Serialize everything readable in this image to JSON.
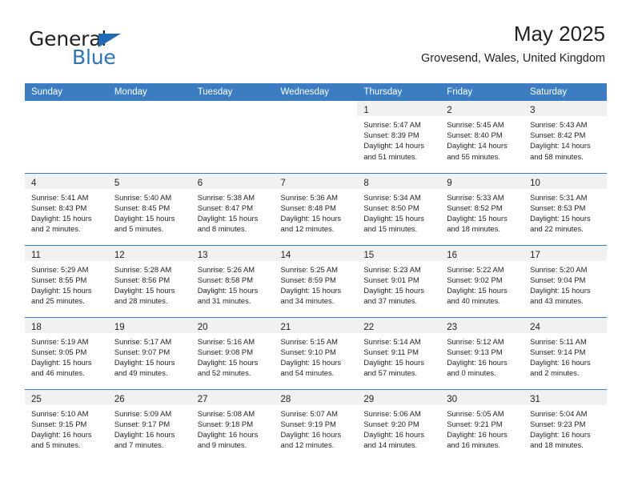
{
  "brand": {
    "name_top": "General",
    "name_bottom": "Blue",
    "triangle_color": "#1f6cb4",
    "blue_color": "#2e74b5"
  },
  "header": {
    "title": "May 2025",
    "subtitle": "Grovesend, Wales, United Kingdom",
    "header_bg": "#3b7dc0",
    "header_text_color": "#ffffff",
    "daycell_strip_bg": "#f1f1f1"
  },
  "weekday_headers": [
    "Sunday",
    "Monday",
    "Tuesday",
    "Wednesday",
    "Thursday",
    "Friday",
    "Saturday"
  ],
  "weeks": [
    [
      {
        "day": "",
        "sunrise": "",
        "sunset": "",
        "daylight_1": "",
        "daylight_2": "",
        "empty": true
      },
      {
        "day": "",
        "sunrise": "",
        "sunset": "",
        "daylight_1": "",
        "daylight_2": "",
        "empty": true
      },
      {
        "day": "",
        "sunrise": "",
        "sunset": "",
        "daylight_1": "",
        "daylight_2": "",
        "empty": true
      },
      {
        "day": "",
        "sunrise": "",
        "sunset": "",
        "daylight_1": "",
        "daylight_2": "",
        "empty": true
      },
      {
        "day": "1",
        "sunrise": "Sunrise: 5:47 AM",
        "sunset": "Sunset: 8:39 PM",
        "daylight_1": "Daylight: 14 hours",
        "daylight_2": "and 51 minutes."
      },
      {
        "day": "2",
        "sunrise": "Sunrise: 5:45 AM",
        "sunset": "Sunset: 8:40 PM",
        "daylight_1": "Daylight: 14 hours",
        "daylight_2": "and 55 minutes."
      },
      {
        "day": "3",
        "sunrise": "Sunrise: 5:43 AM",
        "sunset": "Sunset: 8:42 PM",
        "daylight_1": "Daylight: 14 hours",
        "daylight_2": "and 58 minutes."
      }
    ],
    [
      {
        "day": "4",
        "sunrise": "Sunrise: 5:41 AM",
        "sunset": "Sunset: 8:43 PM",
        "daylight_1": "Daylight: 15 hours",
        "daylight_2": "and 2 minutes."
      },
      {
        "day": "5",
        "sunrise": "Sunrise: 5:40 AM",
        "sunset": "Sunset: 8:45 PM",
        "daylight_1": "Daylight: 15 hours",
        "daylight_2": "and 5 minutes."
      },
      {
        "day": "6",
        "sunrise": "Sunrise: 5:38 AM",
        "sunset": "Sunset: 8:47 PM",
        "daylight_1": "Daylight: 15 hours",
        "daylight_2": "and 8 minutes."
      },
      {
        "day": "7",
        "sunrise": "Sunrise: 5:36 AM",
        "sunset": "Sunset: 8:48 PM",
        "daylight_1": "Daylight: 15 hours",
        "daylight_2": "and 12 minutes."
      },
      {
        "day": "8",
        "sunrise": "Sunrise: 5:34 AM",
        "sunset": "Sunset: 8:50 PM",
        "daylight_1": "Daylight: 15 hours",
        "daylight_2": "and 15 minutes."
      },
      {
        "day": "9",
        "sunrise": "Sunrise: 5:33 AM",
        "sunset": "Sunset: 8:52 PM",
        "daylight_1": "Daylight: 15 hours",
        "daylight_2": "and 18 minutes."
      },
      {
        "day": "10",
        "sunrise": "Sunrise: 5:31 AM",
        "sunset": "Sunset: 8:53 PM",
        "daylight_1": "Daylight: 15 hours",
        "daylight_2": "and 22 minutes."
      }
    ],
    [
      {
        "day": "11",
        "sunrise": "Sunrise: 5:29 AM",
        "sunset": "Sunset: 8:55 PM",
        "daylight_1": "Daylight: 15 hours",
        "daylight_2": "and 25 minutes."
      },
      {
        "day": "12",
        "sunrise": "Sunrise: 5:28 AM",
        "sunset": "Sunset: 8:56 PM",
        "daylight_1": "Daylight: 15 hours",
        "daylight_2": "and 28 minutes."
      },
      {
        "day": "13",
        "sunrise": "Sunrise: 5:26 AM",
        "sunset": "Sunset: 8:58 PM",
        "daylight_1": "Daylight: 15 hours",
        "daylight_2": "and 31 minutes."
      },
      {
        "day": "14",
        "sunrise": "Sunrise: 5:25 AM",
        "sunset": "Sunset: 8:59 PM",
        "daylight_1": "Daylight: 15 hours",
        "daylight_2": "and 34 minutes."
      },
      {
        "day": "15",
        "sunrise": "Sunrise: 5:23 AM",
        "sunset": "Sunset: 9:01 PM",
        "daylight_1": "Daylight: 15 hours",
        "daylight_2": "and 37 minutes."
      },
      {
        "day": "16",
        "sunrise": "Sunrise: 5:22 AM",
        "sunset": "Sunset: 9:02 PM",
        "daylight_1": "Daylight: 15 hours",
        "daylight_2": "and 40 minutes."
      },
      {
        "day": "17",
        "sunrise": "Sunrise: 5:20 AM",
        "sunset": "Sunset: 9:04 PM",
        "daylight_1": "Daylight: 15 hours",
        "daylight_2": "and 43 minutes."
      }
    ],
    [
      {
        "day": "18",
        "sunrise": "Sunrise: 5:19 AM",
        "sunset": "Sunset: 9:05 PM",
        "daylight_1": "Daylight: 15 hours",
        "daylight_2": "and 46 minutes."
      },
      {
        "day": "19",
        "sunrise": "Sunrise: 5:17 AM",
        "sunset": "Sunset: 9:07 PM",
        "daylight_1": "Daylight: 15 hours",
        "daylight_2": "and 49 minutes."
      },
      {
        "day": "20",
        "sunrise": "Sunrise: 5:16 AM",
        "sunset": "Sunset: 9:08 PM",
        "daylight_1": "Daylight: 15 hours",
        "daylight_2": "and 52 minutes."
      },
      {
        "day": "21",
        "sunrise": "Sunrise: 5:15 AM",
        "sunset": "Sunset: 9:10 PM",
        "daylight_1": "Daylight: 15 hours",
        "daylight_2": "and 54 minutes."
      },
      {
        "day": "22",
        "sunrise": "Sunrise: 5:14 AM",
        "sunset": "Sunset: 9:11 PM",
        "daylight_1": "Daylight: 15 hours",
        "daylight_2": "and 57 minutes."
      },
      {
        "day": "23",
        "sunrise": "Sunrise: 5:12 AM",
        "sunset": "Sunset: 9:13 PM",
        "daylight_1": "Daylight: 16 hours",
        "daylight_2": "and 0 minutes."
      },
      {
        "day": "24",
        "sunrise": "Sunrise: 5:11 AM",
        "sunset": "Sunset: 9:14 PM",
        "daylight_1": "Daylight: 16 hours",
        "daylight_2": "and 2 minutes."
      }
    ],
    [
      {
        "day": "25",
        "sunrise": "Sunrise: 5:10 AM",
        "sunset": "Sunset: 9:15 PM",
        "daylight_1": "Daylight: 16 hours",
        "daylight_2": "and 5 minutes."
      },
      {
        "day": "26",
        "sunrise": "Sunrise: 5:09 AM",
        "sunset": "Sunset: 9:17 PM",
        "daylight_1": "Daylight: 16 hours",
        "daylight_2": "and 7 minutes."
      },
      {
        "day": "27",
        "sunrise": "Sunrise: 5:08 AM",
        "sunset": "Sunset: 9:18 PM",
        "daylight_1": "Daylight: 16 hours",
        "daylight_2": "and 9 minutes."
      },
      {
        "day": "28",
        "sunrise": "Sunrise: 5:07 AM",
        "sunset": "Sunset: 9:19 PM",
        "daylight_1": "Daylight: 16 hours",
        "daylight_2": "and 12 minutes."
      },
      {
        "day": "29",
        "sunrise": "Sunrise: 5:06 AM",
        "sunset": "Sunset: 9:20 PM",
        "daylight_1": "Daylight: 16 hours",
        "daylight_2": "and 14 minutes."
      },
      {
        "day": "30",
        "sunrise": "Sunrise: 5:05 AM",
        "sunset": "Sunset: 9:21 PM",
        "daylight_1": "Daylight: 16 hours",
        "daylight_2": "and 16 minutes."
      },
      {
        "day": "31",
        "sunrise": "Sunrise: 5:04 AM",
        "sunset": "Sunset: 9:23 PM",
        "daylight_1": "Daylight: 16 hours",
        "daylight_2": "and 18 minutes."
      }
    ]
  ]
}
